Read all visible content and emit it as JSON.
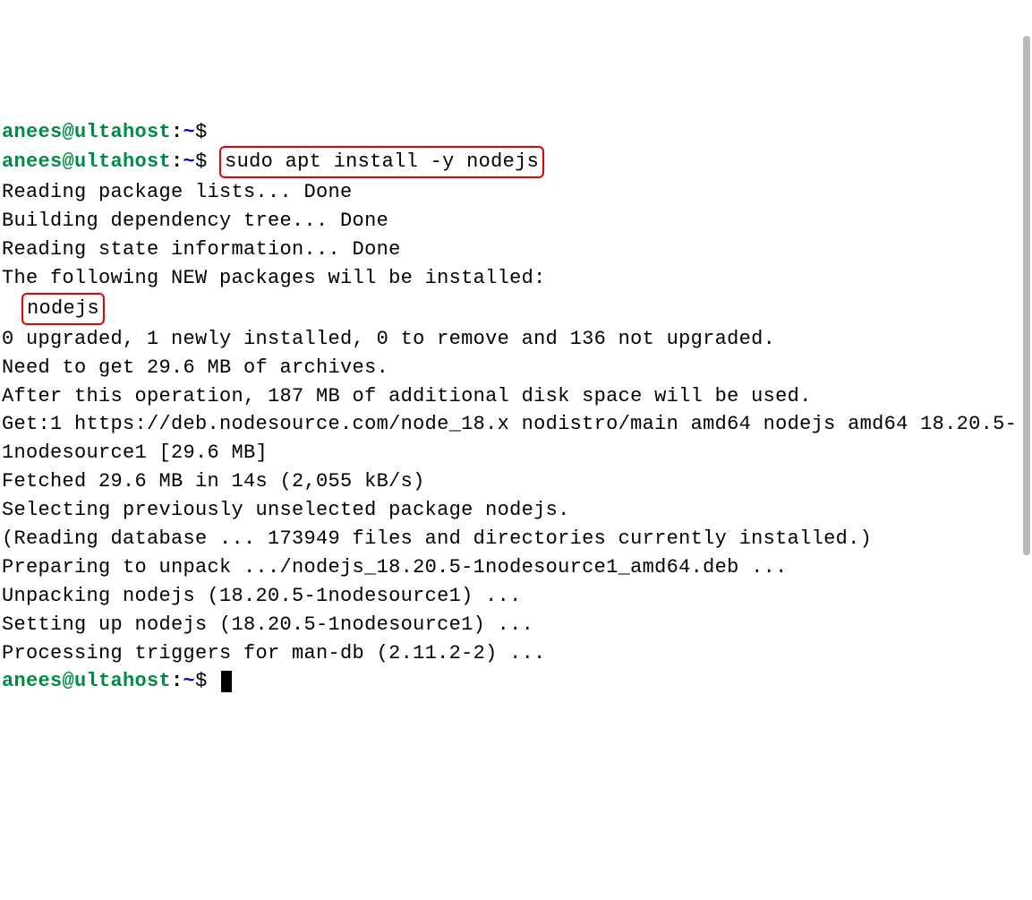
{
  "prompt": {
    "user_host": "anees@ultahost",
    "colon": ":",
    "path": "~",
    "dollar": "$"
  },
  "command": {
    "text": "sudo apt install -y nodejs"
  },
  "output": {
    "line1": "Reading package lists... Done",
    "line2": "Building dependency tree... Done",
    "line3": "Reading state information... Done",
    "line4": "The following NEW packages will be installed:",
    "package_name": "nodejs",
    "line6": "0 upgraded, 1 newly installed, 0 to remove and 136 not upgraded.",
    "line7": "Need to get 29.6 MB of archives.",
    "line8": "After this operation, 187 MB of additional disk space will be used.",
    "line9": "Get:1 https://deb.nodesource.com/node_18.x nodistro/main amd64 nodejs amd64 18.20.5-1nodesource1 [29.6 MB]",
    "line10": "Fetched 29.6 MB in 14s (2,055 kB/s)",
    "line11": "Selecting previously unselected package nodejs.",
    "line12": "(Reading database ... 173949 files and directories currently installed.)",
    "line13": "Preparing to unpack .../nodejs_18.20.5-1nodesource1_amd64.deb ...",
    "line14": "Unpacking nodejs (18.20.5-1nodesource1) ...",
    "line15": "Setting up nodejs (18.20.5-1nodesource1) ...",
    "line16": "Processing triggers for man-db (2.11.2-2) ..."
  }
}
